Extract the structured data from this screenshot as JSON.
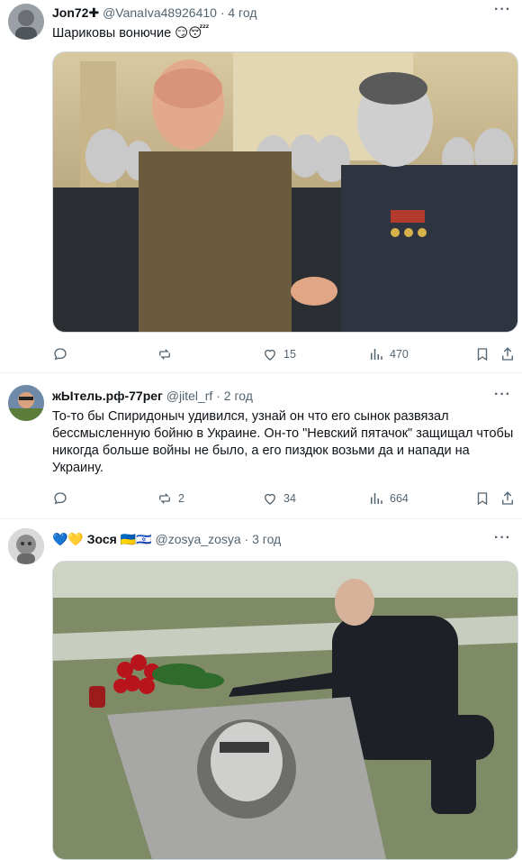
{
  "posts": [
    {
      "author": "Jon72✚",
      "handle": "@VanaIva48926410",
      "time": "· 4 год",
      "text": "Шариковы вонючие 😏😴",
      "stats": {
        "replies": "",
        "reposts": "",
        "likes": "15",
        "views": "470"
      }
    },
    {
      "author": "жЫтель.рф-77рег",
      "handle": "@jitel_rf",
      "time": "· 2 год",
      "text": "То-то бы Спиридоныч удивился, узнай он что его сынок развязал бессмысленную бойню в Украине. Он-то \"Невский пятачок\" защищал чтобы никогда больше войны не было, а его пиздюк возьми да и напади на Украину.",
      "stats": {
        "replies": "",
        "reposts": "2",
        "likes": "34",
        "views": "664"
      }
    },
    {
      "author": "💙💛 Зося 🇺🇦🇮🇱",
      "handle": "@zosya_zosya",
      "time": "· 3 год",
      "text": "",
      "stats": {}
    }
  ],
  "icons": {
    "more": "more-horizontal-icon",
    "reply": "reply-icon",
    "repost": "repost-icon",
    "like": "like-icon",
    "views": "views-icon",
    "bookmark": "bookmark-icon",
    "share": "share-icon"
  },
  "colors": {
    "text": "#0f1419",
    "secondary": "#536471",
    "divider": "#eff3f4",
    "border": "#cfd9de"
  }
}
